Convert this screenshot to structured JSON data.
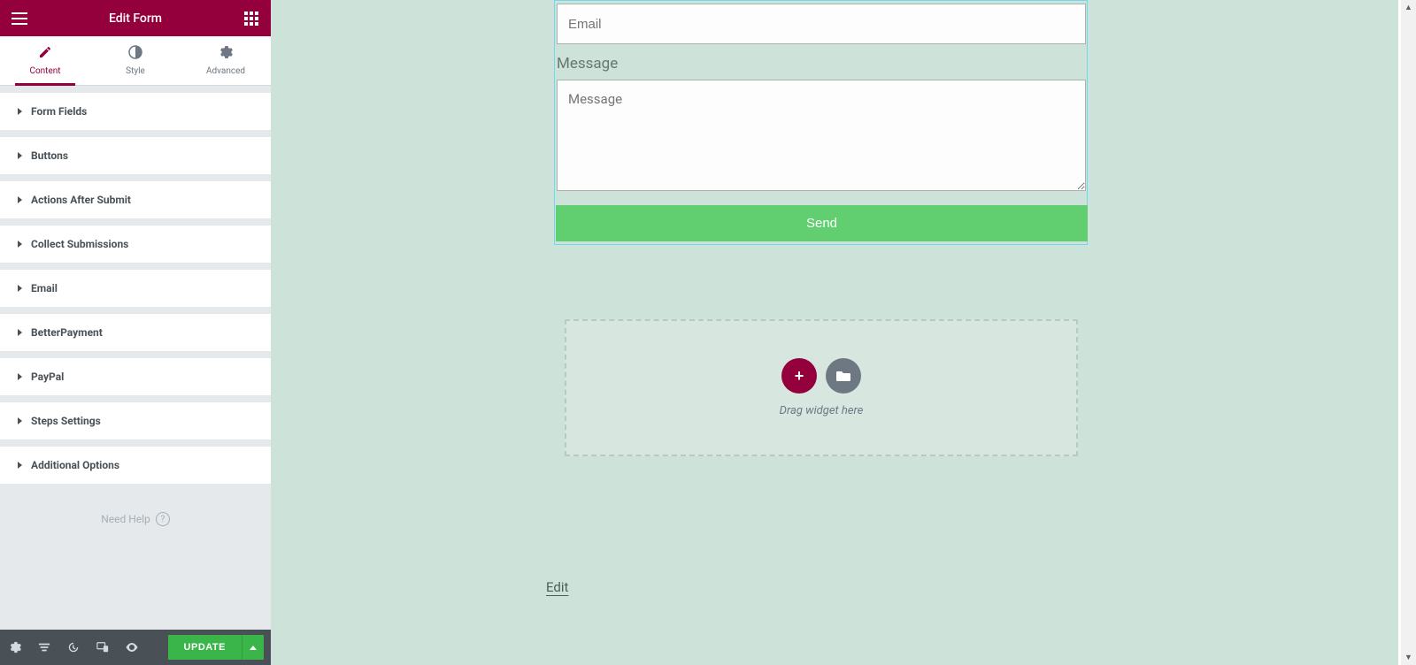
{
  "header": {
    "title": "Edit Form"
  },
  "tabs": [
    {
      "label": "Content",
      "icon": "pencil"
    },
    {
      "label": "Style",
      "icon": "contrast"
    },
    {
      "label": "Advanced",
      "icon": "gear"
    }
  ],
  "sections": [
    "Form Fields",
    "Buttons",
    "Actions After Submit",
    "Collect Submissions",
    "Email",
    "BetterPayment",
    "PayPal",
    "Steps Settings",
    "Additional Options"
  ],
  "help": {
    "label": "Need Help"
  },
  "footer": {
    "update": "UPDATE"
  },
  "form": {
    "email_placeholder": "Email",
    "message_label": "Message",
    "message_placeholder": "Message",
    "send_label": "Send"
  },
  "dropzone": {
    "text": "Drag widget here"
  },
  "edit_link": "Edit"
}
